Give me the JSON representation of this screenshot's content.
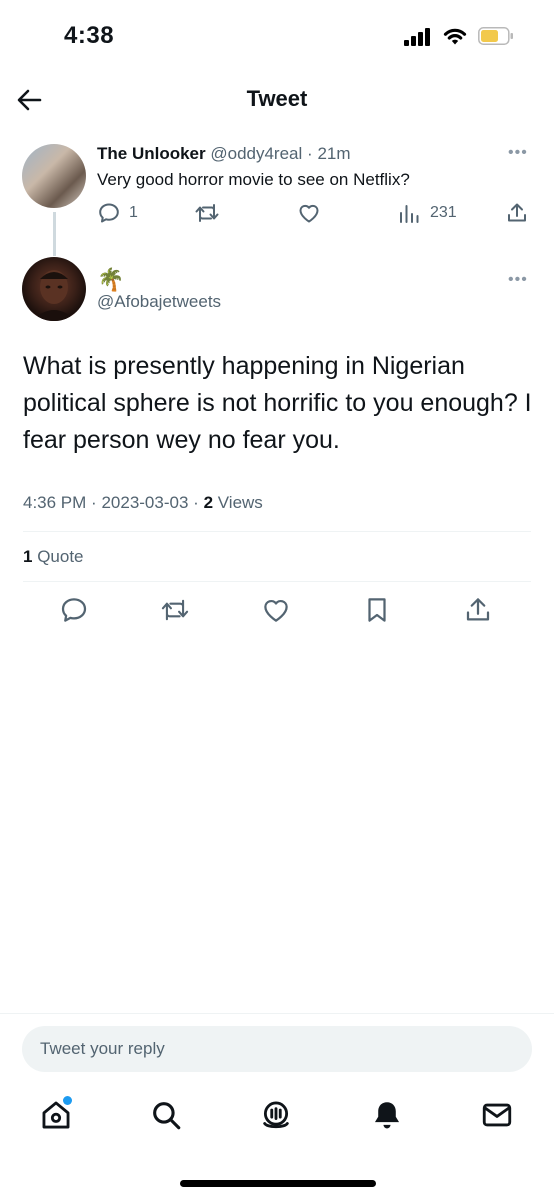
{
  "status_bar": {
    "time": "4:38"
  },
  "header": {
    "title": "Tweet"
  },
  "parent_tweet": {
    "display_name": "The Unlooker",
    "handle": "@oddy4real",
    "separator": "·",
    "time": "21m",
    "text": "Very good horror movie to see on Netflix?",
    "reply_count": "1",
    "views_count": "231"
  },
  "main_tweet": {
    "emoji": "🌴",
    "handle": "@Afobajetweets",
    "text": "What is presently happening in Nigerian political sphere is not horrific to you enough? I fear person wey no fear you.",
    "time": "4:36 PM",
    "separator": "·",
    "date": "2023-03-03",
    "views_count": "2",
    "views_label": "Views",
    "quote_count": "1",
    "quote_label": "Quote"
  },
  "reply": {
    "placeholder": "Tweet your reply"
  },
  "icons": {
    "back": "back-arrow-icon",
    "reply": "reply-icon",
    "retweet": "retweet-icon",
    "like": "heart-icon",
    "views": "analytics-icon",
    "share": "share-icon",
    "bookmark": "bookmark-icon",
    "home": "home-icon",
    "search": "search-icon",
    "spaces": "spaces-icon",
    "notifications": "bell-icon",
    "messages": "mail-icon"
  },
  "colors": {
    "accent": "#1d9bf0",
    "text": "#0f1419",
    "muted": "#536471"
  }
}
